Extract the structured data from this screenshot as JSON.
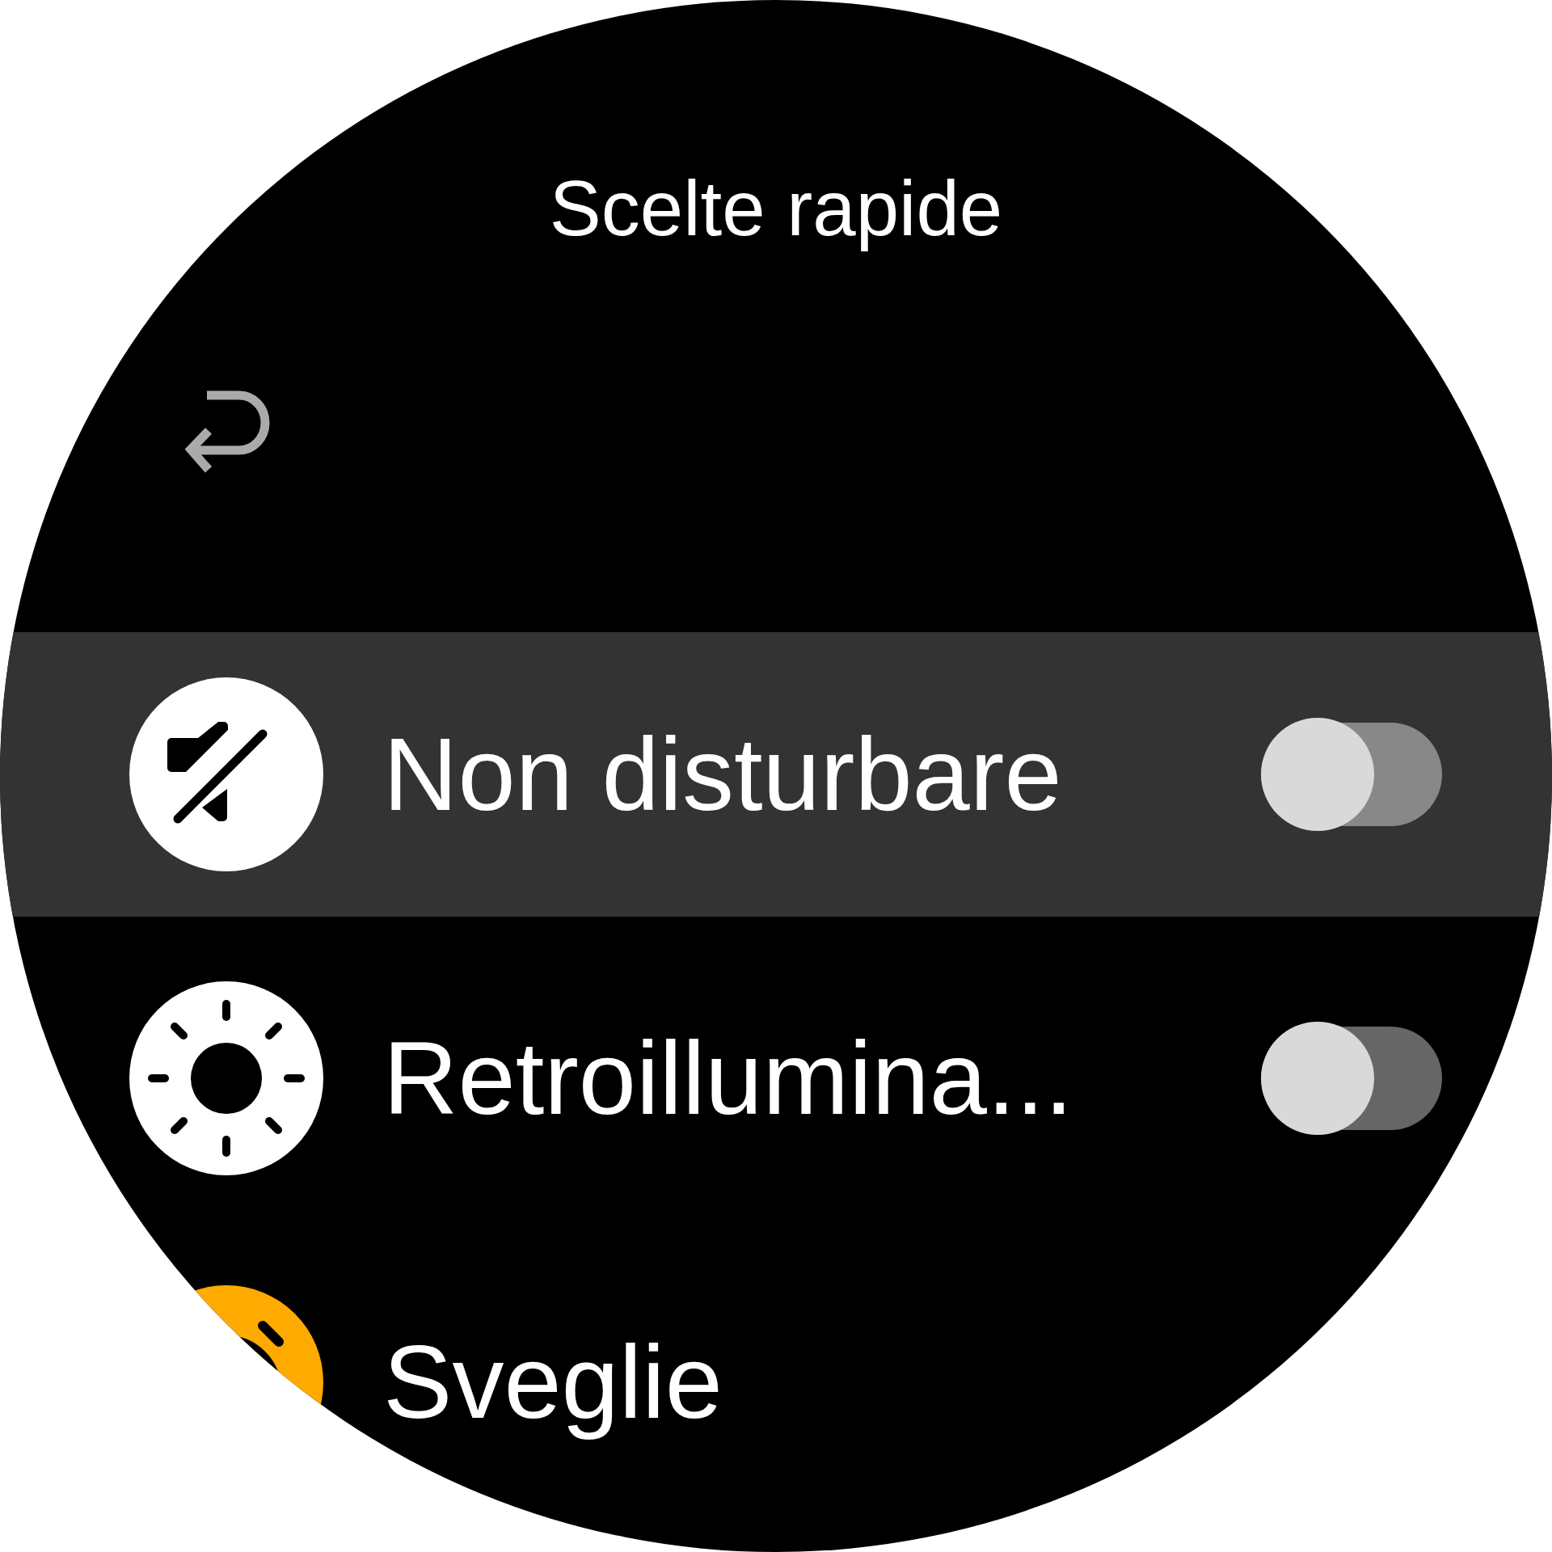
{
  "title": "Scelte rapide",
  "items": [
    {
      "label": "Non disturbare",
      "kind": "toggle",
      "on": false,
      "selected": true,
      "color": "#ffffff"
    },
    {
      "label": "Retroillumina...",
      "kind": "toggle",
      "on": false,
      "selected": false,
      "color": "#ffffff"
    },
    {
      "label": "Sveglie",
      "kind": "link",
      "selected": false,
      "color": "#ffaa00"
    }
  ]
}
